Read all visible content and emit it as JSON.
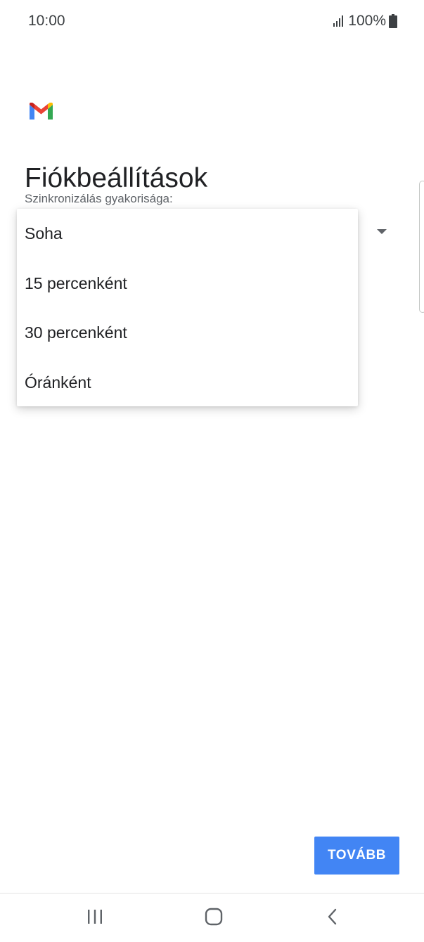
{
  "status_bar": {
    "time": "10:00",
    "battery_text": "100%",
    "icons": [
      "signal-icon",
      "battery-icon"
    ]
  },
  "app": {
    "logo": "gmail-logo",
    "colors": {
      "blue": "#4285f4",
      "red": "#ea4335",
      "yellow": "#fbbc04",
      "green": "#34a853"
    }
  },
  "page": {
    "title": "Fiókbeállítások",
    "sync_label": "Szinkronizálás gyakorisága:",
    "dropdown_icon": "dropdown-arrow-icon"
  },
  "menu": {
    "items": [
      {
        "label": "Soha"
      },
      {
        "label": "15 percenként"
      },
      {
        "label": "30 percenként"
      },
      {
        "label": "Óránként"
      }
    ]
  },
  "actions": {
    "next_label": "TOVÁBB",
    "accent_color": "#4285f4"
  },
  "nav_bar": {
    "icons": [
      "recents-icon",
      "home-icon",
      "back-icon"
    ]
  }
}
